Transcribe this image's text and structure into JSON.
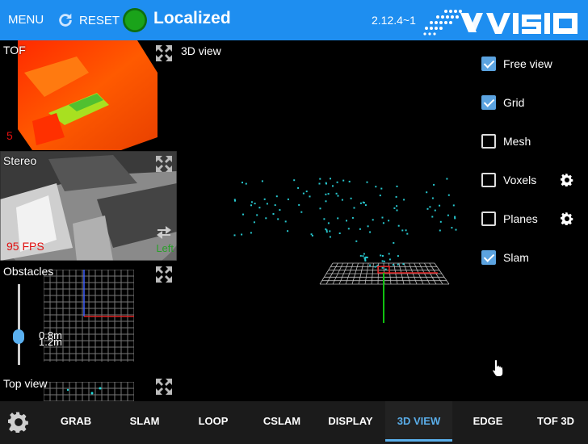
{
  "topbar": {
    "menu_label": "MENU",
    "reset_label": "RESET",
    "status_text": "Localized",
    "status_color": "#1aa31a",
    "version": "2.12.4~1",
    "brand": "xvisio",
    "bar_color": "#1e8ef0"
  },
  "panels": {
    "tof": {
      "title": "TOF",
      "fps": "5"
    },
    "stereo": {
      "title": "Stereo",
      "fps": "95 FPS",
      "side": "Left"
    },
    "obstacles": {
      "title": "Obstacles",
      "value_1": "0.8m",
      "value_2": "1.2m"
    },
    "topview": {
      "title": "Top view"
    }
  },
  "view3d": {
    "title": "3D view",
    "options": [
      {
        "label": "Free view",
        "checked": true,
        "settings": false
      },
      {
        "label": "Grid",
        "checked": true,
        "settings": false
      },
      {
        "label": "Mesh",
        "checked": false,
        "settings": false
      },
      {
        "label": "Voxels",
        "checked": false,
        "settings": true
      },
      {
        "label": "Planes",
        "checked": false,
        "settings": true
      },
      {
        "label": "Slam",
        "checked": true,
        "settings": false
      }
    ]
  },
  "tabs": [
    {
      "label": "GRAB",
      "active": false
    },
    {
      "label": "SLAM",
      "active": false
    },
    {
      "label": "LOOP",
      "active": false
    },
    {
      "label": "CSLAM",
      "active": false
    },
    {
      "label": "DISPLAY",
      "active": false
    },
    {
      "label": "3D VIEW",
      "active": true
    },
    {
      "label": "EDGE",
      "active": false
    },
    {
      "label": "TOF 3D",
      "active": false
    }
  ],
  "icons": {
    "menu": "menu-text",
    "reset": "refresh-icon",
    "settings": "gear-icon",
    "expand": "expand-icon",
    "switch": "swap-arrows-icon"
  }
}
